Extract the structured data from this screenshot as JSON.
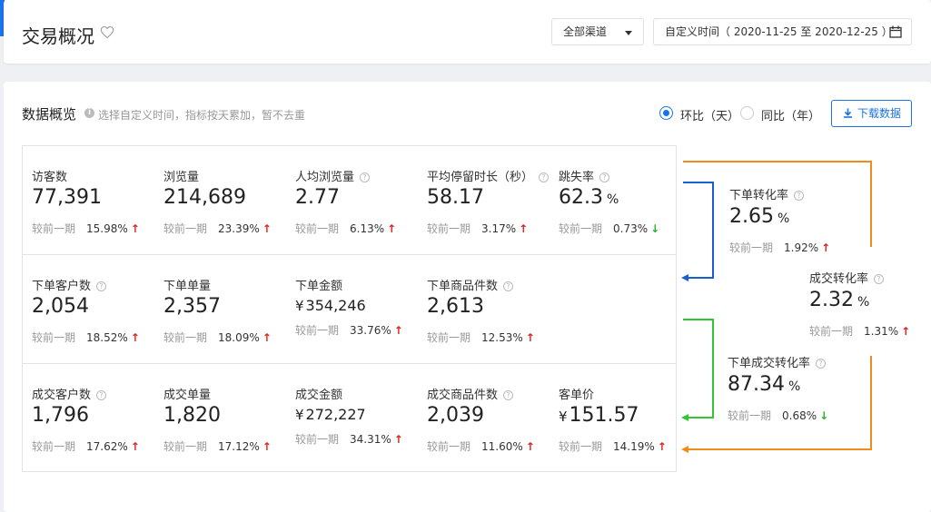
{
  "header": {
    "title": "交易概况",
    "channel_select": "全部渠道",
    "date_range": "自定义时间（ 2020-11-25 至 2020-12-25 ）"
  },
  "panel": {
    "title": "数据概览",
    "hint": "选择自定义时间，指标按天累加，暂不去重",
    "radio_mom": "环比（天）",
    "radio_yoy": "同比（年）",
    "download": "下载数据"
  },
  "compare_label": "较前一期",
  "rows": [
    [
      {
        "label": "访客数",
        "value": "77,391",
        "pct": "15.98%",
        "trend": "↑"
      },
      {
        "label": "浏览量",
        "value": "214,689",
        "pct": "23.39%",
        "trend": "↑"
      },
      {
        "label": "人均浏览量",
        "value": "2.77",
        "pct": "6.13%",
        "trend": "↑"
      },
      {
        "label": "平均停留时长（秒）",
        "value": "58.17",
        "pct": "3.17%",
        "trend": "↑"
      },
      {
        "label": "跳失率",
        "value": "62.3",
        "unit": "%",
        "pct": "0.73%",
        "trend": "↓"
      }
    ],
    [
      {
        "label": "下单客户数",
        "value": "2,054",
        "pct": "18.52%",
        "trend": "↑"
      },
      {
        "label": "下单单量",
        "value": "2,357",
        "pct": "18.09%",
        "trend": "↑"
      },
      {
        "label": "下单金额",
        "currency": "¥",
        "value": "354,246",
        "pct": "33.76%",
        "trend": "↑"
      },
      {
        "label": "下单商品件数",
        "value": "2,613",
        "pct": "12.53%",
        "trend": "↑"
      }
    ],
    [
      {
        "label": "成交客户数",
        "value": "1,796",
        "pct": "17.62%",
        "trend": "↑"
      },
      {
        "label": "成交单量",
        "value": "1,820",
        "pct": "17.12%",
        "trend": "↑"
      },
      {
        "label": "成交金额",
        "currency": "¥",
        "value": "272,227",
        "pct": "34.31%",
        "trend": "↑"
      },
      {
        "label": "成交商品件数",
        "value": "2,039",
        "pct": "11.60%",
        "trend": "↑"
      },
      {
        "label": "客单价",
        "currency": "¥",
        "value": "151.57",
        "pct": "14.19%",
        "trend": "↑"
      }
    ]
  ],
  "conversions": {
    "order_rate": {
      "label": "下单转化率",
      "value": "2.65",
      "unit": "%",
      "pct": "1.92%",
      "trend": "↑"
    },
    "deal_rate": {
      "label": "成交转化率",
      "value": "2.32",
      "unit": "%",
      "pct": "1.31%",
      "trend": "↑"
    },
    "order_deal_rate": {
      "label": "下单成交转化率",
      "value": "87.34",
      "unit": "%",
      "pct": "0.68%",
      "trend": "↓"
    }
  },
  "colors": {
    "accent": "#1a73e8",
    "up": "#e02020",
    "down": "#2ab32a",
    "flow_blue": "#1a5fd0",
    "flow_green": "#33c633",
    "flow_orange": "#f08c1e"
  }
}
